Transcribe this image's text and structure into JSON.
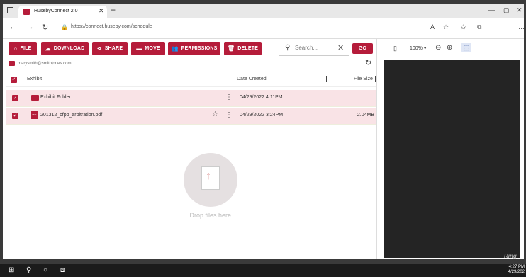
{
  "browser": {
    "tab_title": "HusebyConnect 2.0",
    "url": "https://connect.huseby.com/schedule"
  },
  "toolbar": {
    "buttons": [
      {
        "label": "FILE",
        "icon": "home-icon"
      },
      {
        "label": "DOWNLOAD",
        "icon": "cloud-download-icon"
      },
      {
        "label": "SHARE",
        "icon": "share-icon"
      },
      {
        "label": "MOVE",
        "icon": "folder-icon"
      },
      {
        "label": "PERMISSIONS",
        "icon": "people-icon"
      },
      {
        "label": "DELETE",
        "icon": "trash-icon"
      }
    ],
    "search_placeholder": "Search...",
    "go_label": "GO"
  },
  "breadcrumb": "marysmith@smithjones.com",
  "table": {
    "columns": [
      "Exhibit",
      "Date Created",
      "File Size"
    ],
    "rows": [
      {
        "name": "Exhibit Folder",
        "date": "04/29/2022 4:11PM",
        "size": "",
        "type": "folder"
      },
      {
        "name": "201312_cfpb_arbitration.pdf",
        "date": "04/29/2022 3:24PM",
        "size": "2.04MB",
        "type": "pdf"
      }
    ]
  },
  "dropzone_text": "Drop files here.",
  "preview": {
    "zoom": "100%"
  },
  "watermark": "Ring",
  "taskbar": {
    "time": "4:27 PM",
    "date": "4/29/202"
  },
  "colors": {
    "accent": "#b51c3a",
    "row_selected": "#f9e3e6"
  }
}
